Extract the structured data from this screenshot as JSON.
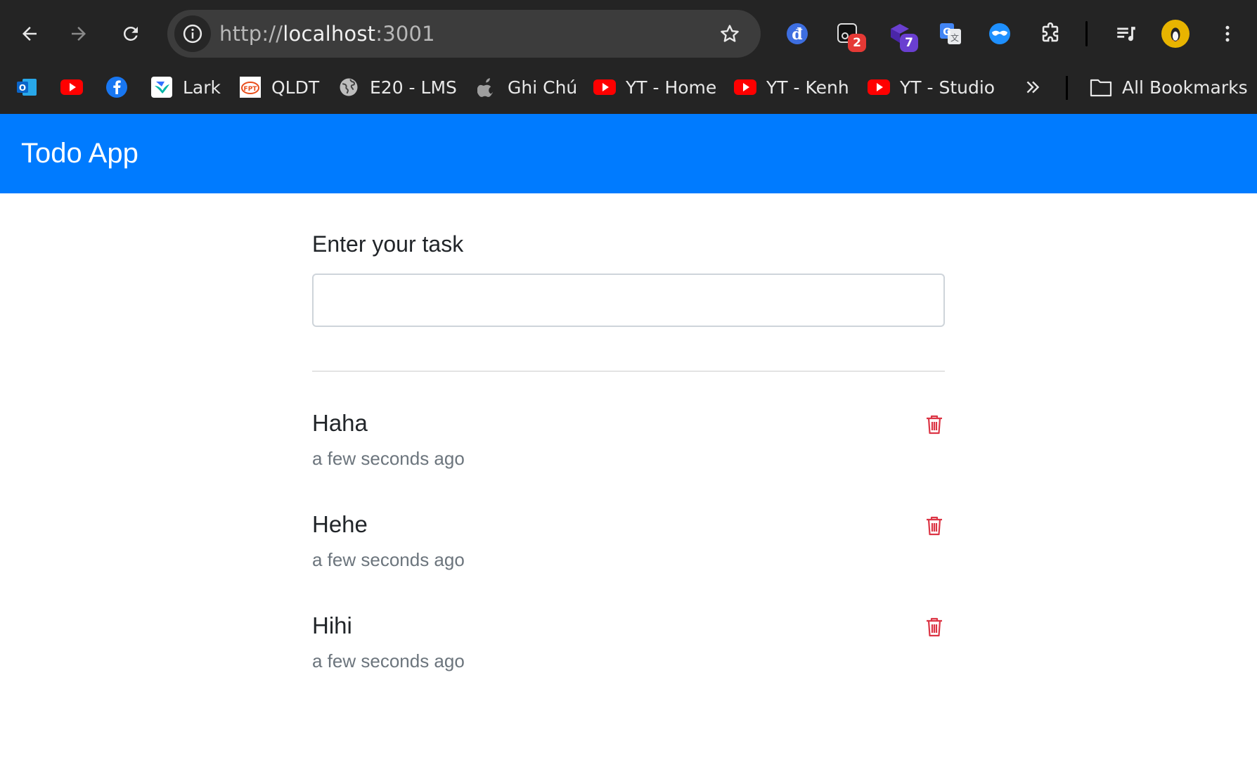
{
  "browser": {
    "url_scheme": "http://",
    "url_host": "localhost",
    "url_port": ":3001",
    "extensions": [
      {
        "name": "dict-icon",
        "badge": ""
      },
      {
        "name": "screenshot-extension-icon",
        "badge": "2"
      },
      {
        "name": "cube-extension-icon",
        "badge": "7"
      },
      {
        "name": "translate-icon",
        "badge": ""
      },
      {
        "name": "mask-icon",
        "badge": ""
      }
    ],
    "bookmarks": [
      {
        "label": "",
        "icon": "outlook-icon"
      },
      {
        "label": "",
        "icon": "youtube-icon"
      },
      {
        "label": "",
        "icon": "facebook-icon"
      },
      {
        "label": "Lark",
        "icon": "lark-icon"
      },
      {
        "label": "QLDT",
        "icon": "fpt-icon"
      },
      {
        "label": "E20 - LMS",
        "icon": "globe-icon"
      },
      {
        "label": "Ghi Chú",
        "icon": "apple-icon"
      },
      {
        "label": "YT - Home",
        "icon": "youtube-icon"
      },
      {
        "label": "YT - Kenh",
        "icon": "youtube-icon"
      },
      {
        "label": "YT - Studio",
        "icon": "youtube-icon"
      }
    ],
    "all_bookmarks_label": "All Bookmarks"
  },
  "app": {
    "brand": "Todo App",
    "task_label": "Enter your task",
    "task_input_value": "",
    "todos": [
      {
        "title": "Haha",
        "time": "a few seconds ago"
      },
      {
        "title": "Hehe",
        "time": "a few seconds ago"
      },
      {
        "title": "Hihi",
        "time": "a few seconds ago"
      }
    ]
  },
  "colors": {
    "navbar": "#007bff",
    "delete": "#dc3545",
    "chrome": "#242424"
  }
}
